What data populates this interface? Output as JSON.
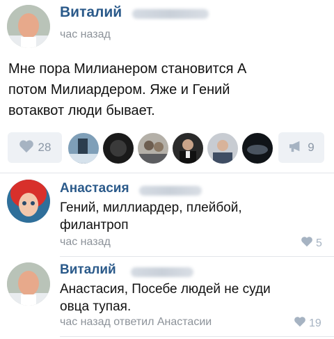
{
  "post": {
    "author_name": "Виталий",
    "time": "час назад",
    "text_lines": [
      "Мне пора Милианером становится А",
      "потом Милиардером. Яже и Гений",
      "вотаквот люди бывает."
    ],
    "likes_count": "28",
    "reposts_count": "9",
    "likers": [
      "liker-1",
      "liker-2",
      "liker-3",
      "liker-4",
      "liker-5",
      "liker-6",
      "liker-7"
    ]
  },
  "comments": [
    {
      "author_name": "Анастасия",
      "text_lines": [
        "Гений, миллиардер, плейбой,",
        "филантроп"
      ],
      "meta": "час назад",
      "likes": "5"
    },
    {
      "author_name": "Виталий",
      "text_lines": [
        "Анастасия, Посебе людей не суди",
        "овца тупая."
      ],
      "meta": "час назад ответил Анастасии",
      "likes": "19"
    }
  ],
  "colors": {
    "name": "#2b5a8a",
    "meta": "#8c9299",
    "button_bg": "#eef1f5",
    "icon": "#a6b3c2"
  },
  "icons": {
    "like": "heart-icon",
    "share": "megaphone-icon"
  }
}
